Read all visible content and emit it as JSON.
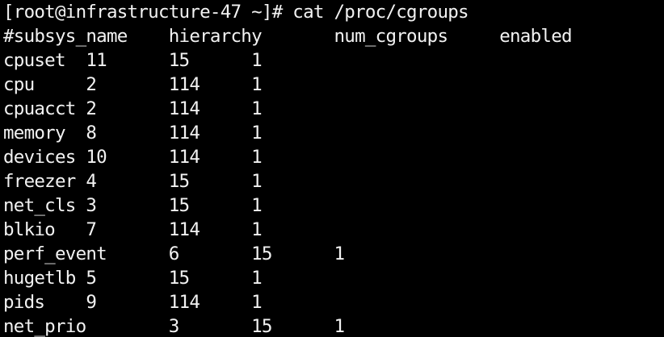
{
  "colors": {
    "background": "#000000",
    "foreground": "#f2f2f2"
  },
  "terminal": {
    "lines": [
      "[root@infrastructure-47 ~]# cat /proc/cgroups",
      "#subsys_name    hierarchy       num_cgroups     enabled",
      "cpuset  11      15      1",
      "cpu     2       114     1",
      "cpuacct 2       114     1",
      "memory  8       114     1",
      "devices 10      114     1",
      "freezer 4       15      1",
      "net_cls 3       15      1",
      "blkio   7       114     1",
      "perf_event      6       15      1",
      "hugetlb 5       15      1",
      "pids    9       114     1",
      "net_prio        3       15      1"
    ]
  }
}
